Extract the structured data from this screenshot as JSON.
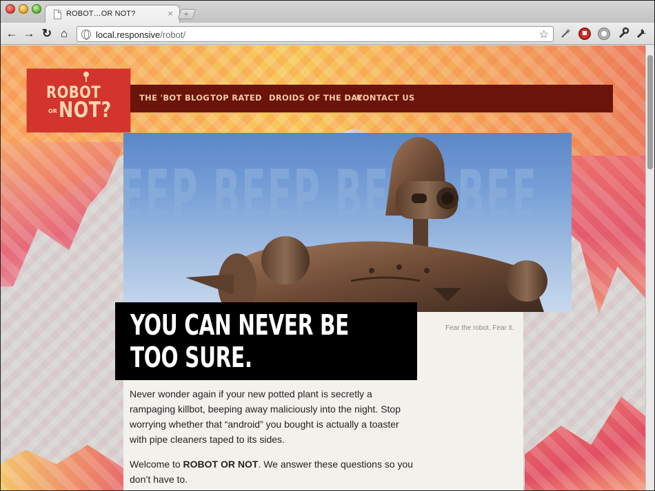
{
  "browser": {
    "tab_title": "ROBOT…OR NOT?",
    "tab_close": "×",
    "new_tab": "+",
    "url_host": "local.responsive",
    "url_path": "/robot/",
    "nav_back": "←",
    "nav_forward": "→",
    "nav_reload": "↻",
    "nav_home": "⌂",
    "star": "☆"
  },
  "site": {
    "logo": {
      "line1": "ROBOT",
      "line2": "OR",
      "line3": "NOT?"
    },
    "nav": [
      {
        "label": "THE 'BOT BLOG"
      },
      {
        "label": "TOP RATED"
      },
      {
        "label": "DROIDS OF THE DAY"
      },
      {
        "label": "CONTACT US"
      }
    ],
    "hero_overlay": "EEP BEEP BEEP BEE",
    "caption": "Fear the robot. Fear it.",
    "headline": {
      "line1": "YOU CAN NEVER BE",
      "line2": "TOO SURE."
    },
    "paragraph1": "Never wonder again if your new potted plant is secretly a rampaging killbot, beeping away maliciously into the night. Stop worrying whether that “android” you bought is actually a toaster with pipe cleaners taped to its sides.",
    "paragraph2": {
      "prefix": "Welcome to ",
      "strong": "ROBOT OR NOT",
      "suffix": ". We answer these questions so you don’t have to."
    }
  },
  "colors": {
    "nav_bg": "#6a140b",
    "nav_text": "#f4c9a4",
    "logo_bg": "#d3342d",
    "headline_bg": "#000000"
  }
}
